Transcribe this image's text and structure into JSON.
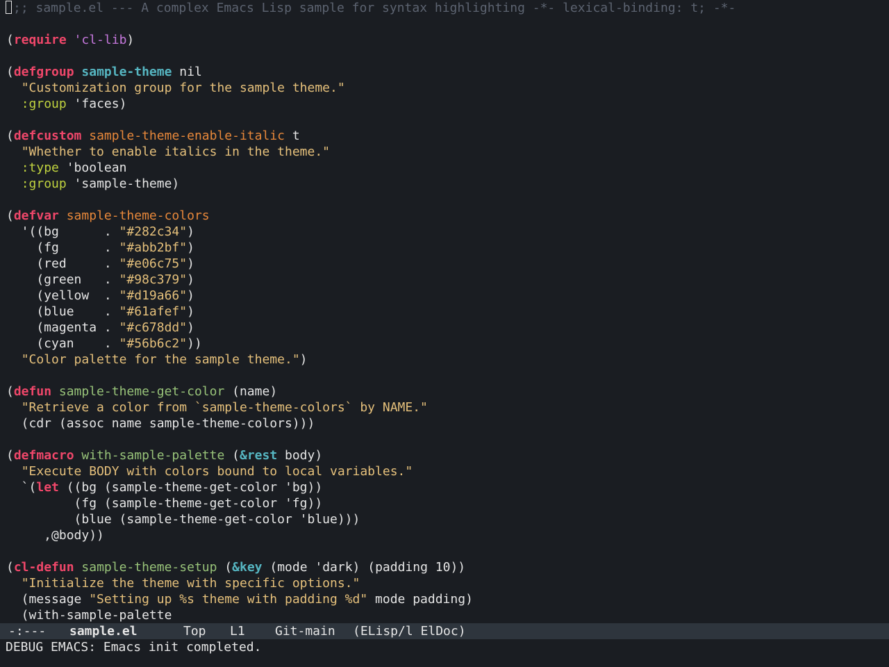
{
  "buffer": {
    "lines": [
      [
        {
          "c": "t-comment",
          "t": ";; sample.el --- A complex Emacs Lisp sample for syntax highlighting -*- lexical-binding: t; -*-"
        }
      ],
      [],
      [
        {
          "c": "t-plain",
          "t": "("
        },
        {
          "c": "t-kw",
          "t": "require"
        },
        {
          "c": "t-plain",
          "t": " "
        },
        {
          "c": "t-quote",
          "t": "'cl-lib"
        },
        {
          "c": "t-plain",
          "t": ")"
        }
      ],
      [],
      [
        {
          "c": "t-plain",
          "t": "("
        },
        {
          "c": "t-kw",
          "t": "defgroup"
        },
        {
          "c": "t-plain",
          "t": " "
        },
        {
          "c": "t-type",
          "t": "sample-theme"
        },
        {
          "c": "t-plain",
          "t": " nil"
        }
      ],
      [
        {
          "c": "t-plain",
          "t": "  "
        },
        {
          "c": "t-str",
          "t": "\"Customization group for the sample theme.\""
        }
      ],
      [
        {
          "c": "t-plain",
          "t": "  "
        },
        {
          "c": "t-key",
          "t": ":group"
        },
        {
          "c": "t-plain",
          "t": " 'faces)"
        }
      ],
      [],
      [
        {
          "c": "t-plain",
          "t": "("
        },
        {
          "c": "t-kw",
          "t": "defcustom"
        },
        {
          "c": "t-plain",
          "t": " "
        },
        {
          "c": "t-var",
          "t": "sample-theme-enable-italic"
        },
        {
          "c": "t-plain",
          "t": " t"
        }
      ],
      [
        {
          "c": "t-plain",
          "t": "  "
        },
        {
          "c": "t-str",
          "t": "\"Whether to enable italics in the theme.\""
        }
      ],
      [
        {
          "c": "t-plain",
          "t": "  "
        },
        {
          "c": "t-key",
          "t": ":type"
        },
        {
          "c": "t-plain",
          "t": " 'boolean"
        }
      ],
      [
        {
          "c": "t-plain",
          "t": "  "
        },
        {
          "c": "t-key",
          "t": ":group"
        },
        {
          "c": "t-plain",
          "t": " 'sample-theme)"
        }
      ],
      [],
      [
        {
          "c": "t-plain",
          "t": "("
        },
        {
          "c": "t-kw",
          "t": "defvar"
        },
        {
          "c": "t-plain",
          "t": " "
        },
        {
          "c": "t-var",
          "t": "sample-theme-colors"
        }
      ],
      [
        {
          "c": "t-plain",
          "t": "  '((bg      . "
        },
        {
          "c": "t-str",
          "t": "\"#282c34\""
        },
        {
          "c": "t-plain",
          "t": ")"
        }
      ],
      [
        {
          "c": "t-plain",
          "t": "    (fg      . "
        },
        {
          "c": "t-str",
          "t": "\"#abb2bf\""
        },
        {
          "c": "t-plain",
          "t": ")"
        }
      ],
      [
        {
          "c": "t-plain",
          "t": "    (red     . "
        },
        {
          "c": "t-str",
          "t": "\"#e06c75\""
        },
        {
          "c": "t-plain",
          "t": ")"
        }
      ],
      [
        {
          "c": "t-plain",
          "t": "    (green   . "
        },
        {
          "c": "t-str",
          "t": "\"#98c379\""
        },
        {
          "c": "t-plain",
          "t": ")"
        }
      ],
      [
        {
          "c": "t-plain",
          "t": "    (yellow  . "
        },
        {
          "c": "t-str",
          "t": "\"#d19a66\""
        },
        {
          "c": "t-plain",
          "t": ")"
        }
      ],
      [
        {
          "c": "t-plain",
          "t": "    (blue    . "
        },
        {
          "c": "t-str",
          "t": "\"#61afef\""
        },
        {
          "c": "t-plain",
          "t": ")"
        }
      ],
      [
        {
          "c": "t-plain",
          "t": "    (magenta . "
        },
        {
          "c": "t-str",
          "t": "\"#c678dd\""
        },
        {
          "c": "t-plain",
          "t": ")"
        }
      ],
      [
        {
          "c": "t-plain",
          "t": "    (cyan    . "
        },
        {
          "c": "t-str",
          "t": "\"#56b6c2\""
        },
        {
          "c": "t-plain",
          "t": "))"
        }
      ],
      [
        {
          "c": "t-plain",
          "t": "  "
        },
        {
          "c": "t-str",
          "t": "\"Color palette for the sample theme.\""
        },
        {
          "c": "t-plain",
          "t": ")"
        }
      ],
      [],
      [
        {
          "c": "t-plain",
          "t": "("
        },
        {
          "c": "t-kw",
          "t": "defun"
        },
        {
          "c": "t-plain",
          "t": " "
        },
        {
          "c": "t-fn",
          "t": "sample-theme-get-color"
        },
        {
          "c": "t-plain",
          "t": " (name)"
        }
      ],
      [
        {
          "c": "t-plain",
          "t": "  "
        },
        {
          "c": "t-str",
          "t": "\"Retrieve a color from `sample-theme-colors` by NAME.\""
        }
      ],
      [
        {
          "c": "t-plain",
          "t": "  (cdr (assoc name sample-theme-colors)))"
        }
      ],
      [],
      [
        {
          "c": "t-plain",
          "t": "("
        },
        {
          "c": "t-kw",
          "t": "defmacro"
        },
        {
          "c": "t-plain",
          "t": " "
        },
        {
          "c": "t-fn",
          "t": "with-sample-palette"
        },
        {
          "c": "t-plain",
          "t": " ("
        },
        {
          "c": "t-type",
          "t": "&rest"
        },
        {
          "c": "t-plain",
          "t": " body)"
        }
      ],
      [
        {
          "c": "t-plain",
          "t": "  "
        },
        {
          "c": "t-str",
          "t": "\"Execute BODY with colors bound to local variables.\""
        }
      ],
      [
        {
          "c": "t-plain",
          "t": "  `("
        },
        {
          "c": "t-kw",
          "t": "let"
        },
        {
          "c": "t-plain",
          "t": " ((bg (sample-theme-get-color 'bg))"
        }
      ],
      [
        {
          "c": "t-plain",
          "t": "         (fg (sample-theme-get-color 'fg))"
        }
      ],
      [
        {
          "c": "t-plain",
          "t": "         (blue (sample-theme-get-color 'blue)))"
        }
      ],
      [
        {
          "c": "t-plain",
          "t": "     ,@body))"
        }
      ],
      [],
      [
        {
          "c": "t-plain",
          "t": "("
        },
        {
          "c": "t-kw",
          "t": "cl-defun"
        },
        {
          "c": "t-plain",
          "t": " "
        },
        {
          "c": "t-fn",
          "t": "sample-theme-setup"
        },
        {
          "c": "t-plain",
          "t": " ("
        },
        {
          "c": "t-type",
          "t": "&key"
        },
        {
          "c": "t-plain",
          "t": " (mode 'dark) (padding 10))"
        }
      ],
      [
        {
          "c": "t-plain",
          "t": "  "
        },
        {
          "c": "t-str",
          "t": "\"Initialize the theme with specific options.\""
        }
      ],
      [
        {
          "c": "t-plain",
          "t": "  (message "
        },
        {
          "c": "t-str",
          "t": "\"Setting up %s theme with padding %d\""
        },
        {
          "c": "t-plain",
          "t": " mode padding)"
        }
      ],
      [
        {
          "c": "t-plain",
          "t": "  (with-sample-palette"
        }
      ]
    ]
  },
  "modeline": {
    "status": "-:---",
    "buffer_name": "sample.el",
    "position": "Top",
    "line": "L1",
    "vc": "Git-main",
    "modes": "(ELisp/l ElDoc)"
  },
  "echo_area": {
    "message": "DEBUG EMACS: Emacs init completed."
  },
  "colors": {
    "background": "#1a1d22",
    "modeline_bg": "#2e353d",
    "keyword": "#f0476a",
    "string": "#e5c07b",
    "function": "#98c379",
    "variable": "#e8883a",
    "type": "#56b6c2",
    "constant": "#c678dd",
    "comment": "#5c6370"
  }
}
